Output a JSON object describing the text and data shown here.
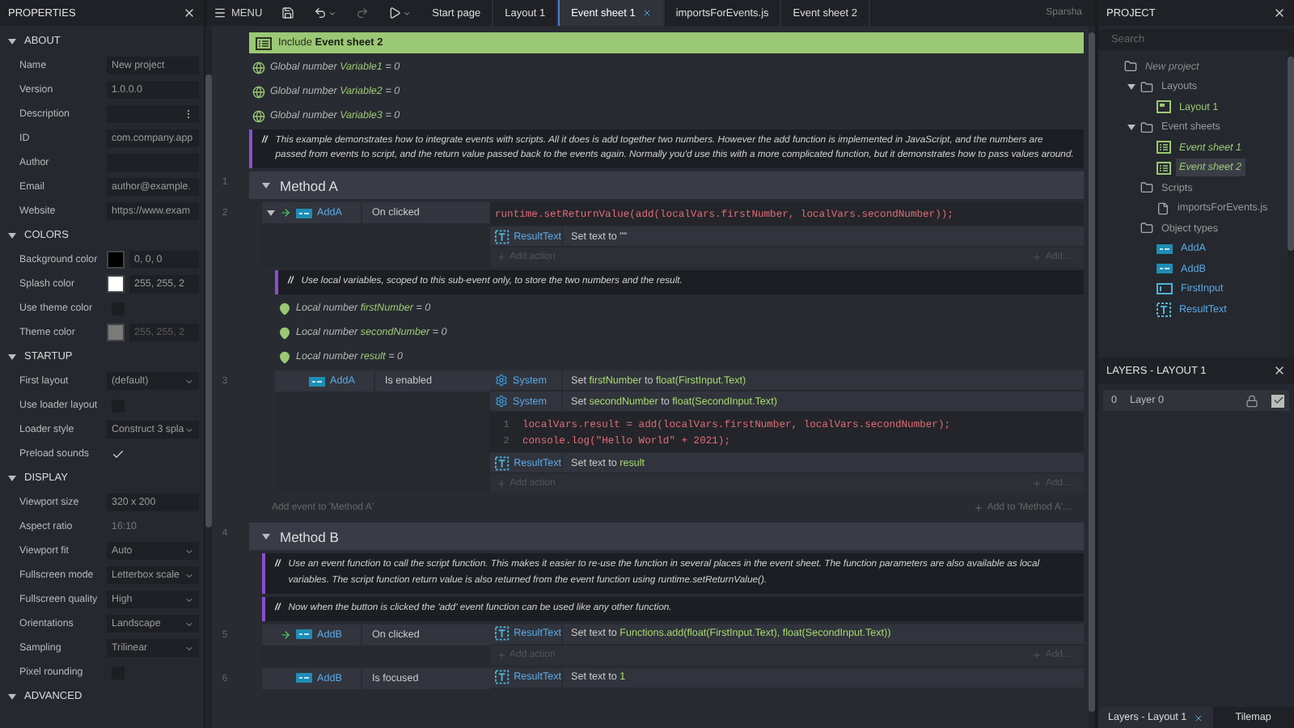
{
  "properties": {
    "title": "PROPERTIES",
    "sections": [
      {
        "title": "ABOUT",
        "expanded": true,
        "rows": [
          {
            "label": "Name",
            "kind": "text",
            "value": "New project"
          },
          {
            "label": "Version",
            "kind": "text",
            "value": "1.0.0.0"
          },
          {
            "label": "Description",
            "kind": "dots"
          },
          {
            "label": "ID",
            "kind": "text",
            "value": "com.company.app"
          },
          {
            "label": "Author",
            "kind": "text"
          },
          {
            "label": "Email",
            "kind": "text",
            "value": "author@example."
          },
          {
            "label": "Website",
            "kind": "text",
            "value": "https://www.exam"
          }
        ]
      },
      {
        "title": "COLORS",
        "expanded": true,
        "rows": [
          {
            "label": "Background color",
            "kind": "color",
            "color": "#000000",
            "value": "0, 0, 0",
            "disabled": false
          },
          {
            "label": "Splash color",
            "kind": "color",
            "color": "#ffffff",
            "value": "255, 255, 2",
            "disabled": false
          },
          {
            "label": "Use theme color",
            "kind": "check",
            "checked": false
          },
          {
            "label": "Theme color",
            "kind": "color",
            "color": "#7a7a7a",
            "value": "255, 255, 2",
            "disabled": true
          }
        ]
      },
      {
        "title": "STARTUP",
        "expanded": true,
        "rows": [
          {
            "label": "First layout",
            "kind": "select",
            "value": "(default)"
          },
          {
            "label": "Use loader layout",
            "kind": "check",
            "checked": false
          },
          {
            "label": "Loader style",
            "kind": "select",
            "value": "Construct 3 spla"
          },
          {
            "label": "Preload sounds",
            "kind": "check",
            "checked": true
          }
        ]
      },
      {
        "title": "DISPLAY",
        "expanded": true,
        "rows": [
          {
            "label": "Viewport size",
            "kind": "text",
            "value": "320 x 200"
          },
          {
            "label": "Aspect ratio",
            "kind": "static",
            "value": "16:10"
          },
          {
            "label": "Viewport fit",
            "kind": "select",
            "value": "Auto"
          },
          {
            "label": "Fullscreen mode",
            "kind": "select",
            "value": "Letterbox scale"
          },
          {
            "label": "Fullscreen quality",
            "kind": "select",
            "value": "High"
          },
          {
            "label": "Orientations",
            "kind": "select",
            "value": "Landscape"
          },
          {
            "label": "Sampling",
            "kind": "select",
            "value": "Trilinear"
          },
          {
            "label": "Pixel rounding",
            "kind": "check",
            "checked": false
          }
        ]
      },
      {
        "title": "ADVANCED",
        "expanded": true
      }
    ]
  },
  "toolbar": {
    "menu": "MENU",
    "user": "Sparsha"
  },
  "tabs": [
    {
      "label": "Start page",
      "selected": false
    },
    {
      "label": "Layout 1",
      "selected": false
    },
    {
      "label": "Event sheet 1",
      "selected": true
    },
    {
      "label": "importsForEvents.js",
      "selected": false
    },
    {
      "label": "Event sheet 2",
      "selected": false
    }
  ],
  "sheet": [
    {
      "kind": "include",
      "text": "Include **Event sheet 2**"
    },
    {
      "kind": "global",
      "prefix": "Global number",
      "name": "Variable1",
      "value": "= 0"
    },
    {
      "kind": "global",
      "prefix": "Global number",
      "name": "Variable2",
      "value": "= 0"
    },
    {
      "kind": "global",
      "prefix": "Global number",
      "name": "Variable3",
      "value": "= 0"
    },
    {
      "kind": "comment",
      "prefix": "//",
      "text": "This example demonstrates how to integrate events with scripts. All it does is add together two numbers. However the add function is implemented in JavaScript, and the numbers are passed from events to script, and the return value passed back to the events again. Normally you'd use this with a more complicated function, but it demonstrates how to pass values around."
    },
    {
      "kind": "group",
      "number": "1",
      "title": "Method A",
      "expanded": true,
      "add_event": "Add event to 'Method A'",
      "add_to": "Add to 'Method A'...",
      "children": [
        {
          "kind": "event",
          "number": "2",
          "expanded": true,
          "conditions": [
            {
              "kind": "button",
              "object": "AddA",
              "text": "On clicked",
              "trigger": true
            }
          ],
          "actions": [
            {
              "kind": "script",
              "lines": [
                {
                  "code": "runtime.setReturnValue(add(localVars.firstNumber, localVars.secondNumber));"
                }
              ]
            },
            {
              "kind": "text",
              "object": "ResultText",
              "text": "Set text to \"\""
            }
          ],
          "add_action": "Add action",
          "add_more": "Add...",
          "children": [
            {
              "kind": "comment",
              "prefix": "//",
              "text": "Use local variables, scoped to this sub-event only, to store the two numbers and the result."
            },
            {
              "kind": "local",
              "prefix": "Local number",
              "name": "firstNumber",
              "value": "= 0"
            },
            {
              "kind": "local",
              "prefix": "Local number",
              "name": "secondNumber",
              "value": "= 0"
            },
            {
              "kind": "local",
              "prefix": "Local number",
              "name": "result",
              "value": "= 0"
            },
            {
              "kind": "event",
              "number": "3",
              "conditions": [
                {
                  "kind": "button",
                  "object": "AddA",
                  "text": "Is enabled",
                  "trigger": false
                }
              ],
              "actions": [
                {
                  "kind": "system",
                  "object": "System",
                  "text": "Set **firstNumber** to **float(FirstInput.Text)**"
                },
                {
                  "kind": "system",
                  "object": "System",
                  "text": "Set **secondNumber** to **float(SecondInput.Text)**"
                },
                {
                  "kind": "script",
                  "lines": [
                    {
                      "no": "1",
                      "code": "localVars.result = add(localVars.firstNumber, localVars.secondNumber);"
                    },
                    {
                      "no": "2",
                      "code": "console.log(\"Hello World\" + 2021);"
                    }
                  ]
                },
                {
                  "kind": "text",
                  "object": "ResultText",
                  "text": "Set text to **result**"
                }
              ],
              "add_action": "Add action",
              "add_more": "Add..."
            }
          ]
        }
      ]
    },
    {
      "kind": "group",
      "number": "4",
      "title": "Method B",
      "expanded": true,
      "children": [
        {
          "kind": "comment",
          "prefix": "//",
          "text": "Use an event function to call the script function. This makes it easier to re-use the function in several places in the event sheet. The function parameters are also available as local variables. The script function return value is also returned from the event function using runtime.setReturnValue()."
        },
        {
          "kind": "comment",
          "prefix": "//",
          "text": "Now when the button is clicked the 'add' event function can be used like any other function."
        },
        {
          "kind": "event",
          "number": "5",
          "conditions": [
            {
              "kind": "button",
              "object": "AddB",
              "text": "On clicked",
              "trigger": true
            }
          ],
          "actions": [
            {
              "kind": "text",
              "object": "ResultText",
              "text": "Set text to **Functions.add(float(FirstInput.Text), float(SecondInput.Text))**"
            }
          ],
          "add_action": "Add action",
          "add_more": "Add..."
        },
        {
          "kind": "event",
          "number": "6",
          "conditions": [
            {
              "kind": "button",
              "object": "AddB",
              "text": "Is focused",
              "trigger": false
            }
          ],
          "actions": [
            {
              "kind": "text",
              "object": "ResultText",
              "text": "Set text to **1**"
            }
          ]
        }
      ]
    }
  ],
  "project": {
    "title": "PROJECT",
    "search": {
      "placeholder": "Search"
    },
    "tree": [
      {
        "label": "New project",
        "kind": "root",
        "selected": false,
        "children": [
          {
            "label": "Layouts",
            "kind": "folder",
            "expanded": true,
            "selected": false,
            "children": [
              {
                "label": "Layout 1",
                "kind": "layout",
                "selected": false
              }
            ]
          },
          {
            "label": "Event sheets",
            "kind": "folder",
            "expanded": true,
            "selected": false,
            "children": [
              {
                "label": "Event sheet 1",
                "kind": "sheet",
                "selected": false
              },
              {
                "label": "Event sheet 2",
                "kind": "sheet",
                "selected": true
              }
            ]
          },
          {
            "label": "Scripts",
            "kind": "folder",
            "selected": false,
            "children": [
              {
                "label": "importsForEvents.js",
                "kind": "script",
                "selected": false
              }
            ]
          },
          {
            "label": "Object types",
            "kind": "folder",
            "selected": false,
            "children": [
              {
                "label": "AddA",
                "kind": "button",
                "selected": false
              },
              {
                "label": "AddB",
                "kind": "button",
                "selected": false
              },
              {
                "label": "FirstInput",
                "kind": "textinput",
                "selected": false
              },
              {
                "label": "ResultText",
                "kind": "text",
                "selected": false
              }
            ]
          }
        ]
      }
    ]
  },
  "layers": {
    "title": "LAYERS - LAYOUT 1",
    "rows": [
      {
        "index": "0",
        "name": "Layer 0",
        "visible": true
      }
    ]
  },
  "bottom_tabs": [
    {
      "label": "Layers - Layout 1",
      "selected": true
    },
    {
      "label": "Tilemap",
      "selected": false
    }
  ]
}
